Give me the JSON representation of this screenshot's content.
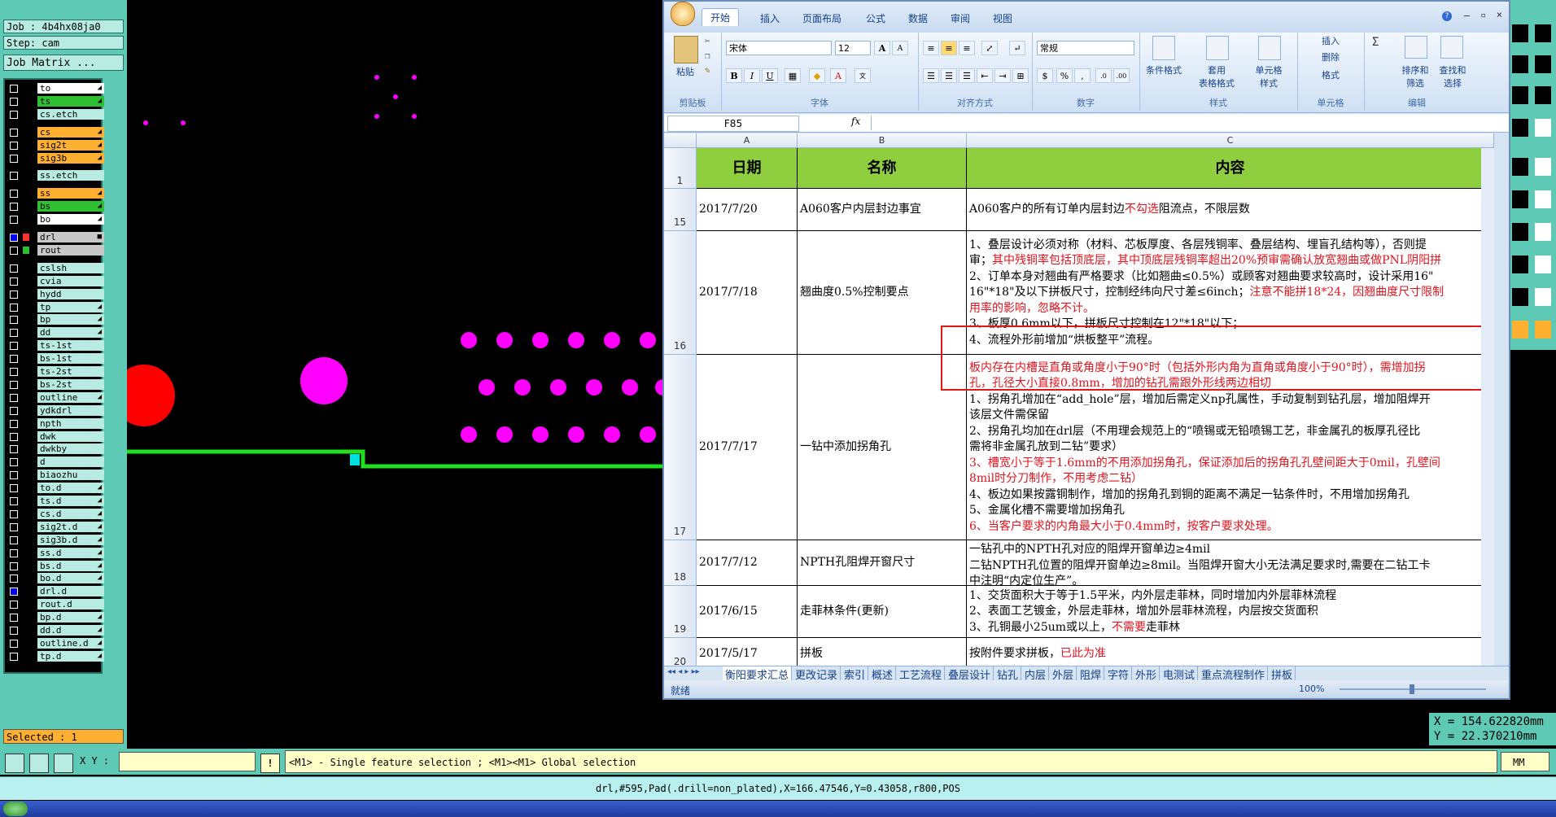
{
  "cam": {
    "job": "Job : 4b4hx08ja0",
    "step": "Step: cam",
    "job_matrix": "Job Matrix ...",
    "selected": "Selected : 1",
    "layers": [
      {
        "name": "to",
        "style": "white",
        "flag": "◢"
      },
      {
        "name": "ts",
        "style": "green",
        "flag": "◢"
      },
      {
        "name": "cs.etch",
        "style": "",
        "flag": ""
      },
      {
        "name": "cs",
        "style": "orange",
        "flag": "◢"
      },
      {
        "name": "sig2t",
        "style": "orange",
        "flag": "◢"
      },
      {
        "name": "sig3b",
        "style": "orange",
        "flag": "◢"
      },
      {
        "name": "ss.etch",
        "style": "",
        "flag": ""
      },
      {
        "name": "ss",
        "style": "orange",
        "flag": "◢"
      },
      {
        "name": "bs",
        "style": "green",
        "flag": "◢"
      },
      {
        "name": "bo",
        "style": "white",
        "flag": "◢"
      },
      {
        "name": "drl",
        "style": "grey",
        "flag": "■"
      },
      {
        "name": "rout",
        "style": "grey",
        "flag": ""
      },
      {
        "name": "cslsh",
        "style": "",
        "flag": ""
      },
      {
        "name": "cvia",
        "style": "",
        "flag": ""
      },
      {
        "name": "hydd",
        "style": "",
        "flag": ""
      },
      {
        "name": "tp",
        "style": "",
        "flag": "◢"
      },
      {
        "name": "bp",
        "style": "",
        "flag": "◢"
      },
      {
        "name": "dd",
        "style": "",
        "flag": "◢"
      },
      {
        "name": "ts-1st",
        "style": "",
        "flag": ""
      },
      {
        "name": "bs-1st",
        "style": "",
        "flag": ""
      },
      {
        "name": "ts-2st",
        "style": "",
        "flag": ""
      },
      {
        "name": "bs-2st",
        "style": "",
        "flag": ""
      },
      {
        "name": "outline",
        "style": "",
        "flag": "◢"
      },
      {
        "name": "ydkdrl",
        "style": "",
        "flag": ""
      },
      {
        "name": "npth",
        "style": "",
        "flag": ""
      },
      {
        "name": "dwk",
        "style": "",
        "flag": ""
      },
      {
        "name": "dwkby",
        "style": "",
        "flag": ""
      },
      {
        "name": "d",
        "style": "",
        "flag": ""
      },
      {
        "name": "biaozhu",
        "style": "",
        "flag": ""
      },
      {
        "name": "to.d",
        "style": "",
        "flag": "◢"
      },
      {
        "name": "ts.d",
        "style": "",
        "flag": "◢"
      },
      {
        "name": "cs.d",
        "style": "",
        "flag": "◢"
      },
      {
        "name": "sig2t.d",
        "style": "",
        "flag": "◢"
      },
      {
        "name": "sig3b.d",
        "style": "",
        "flag": "◢"
      },
      {
        "name": "ss.d",
        "style": "",
        "flag": "◢"
      },
      {
        "name": "bs.d",
        "style": "",
        "flag": "◢"
      },
      {
        "name": "bo.d",
        "style": "",
        "flag": "◢"
      },
      {
        "name": "drl.d",
        "style": "",
        "flag": ""
      },
      {
        "name": "rout.d",
        "style": "",
        "flag": ""
      },
      {
        "name": "bp.d",
        "style": "",
        "flag": "◢"
      },
      {
        "name": "dd.d",
        "style": "",
        "flag": "◢"
      },
      {
        "name": "outline.d",
        "style": "",
        "flag": "◢"
      },
      {
        "name": "tp.d",
        "style": "",
        "flag": "◢"
      }
    ],
    "xy_label": "X Y :",
    "prompt": "<M1> - Single feature selection ; <M1><M1> Global selection",
    "units": "MM",
    "info": "drl,#595,Pad(.drill=non_plated),X=166.47546,Y=0.43058,r800,POS",
    "coord_x": "X = 154.622820mm",
    "coord_y": "Y = 22.370210mm"
  },
  "excel": {
    "tabs": [
      "开始",
      "插入",
      "页面布局",
      "公式",
      "数据",
      "审阅",
      "视图"
    ],
    "font_name": "宋体",
    "font_size": "12",
    "number_format": "常规",
    "groups": {
      "clipboard": "剪贴板",
      "font": "字体",
      "align": "对齐方式",
      "number": "数字",
      "styles": "样式",
      "cells": "单元格",
      "edit": "编辑"
    },
    "paste": "粘贴",
    "cond_format": "条件格式",
    "table_format_1": "套用",
    "table_format_2": "表格格式",
    "cell_style_1": "单元格",
    "cell_style_2": "样式",
    "insert": "插入",
    "delete": "删除",
    "format": "格式",
    "sort_1": "排序和",
    "sort_2": "筛选",
    "find_1": "查找和",
    "find_2": "选择",
    "name_box": "F85",
    "fx": "fx",
    "cols": [
      "A",
      "B",
      "C"
    ],
    "headers": [
      "日期",
      "名称",
      "内容"
    ],
    "rows": [
      {
        "num": "15",
        "date": "2017/7/20",
        "name": "A060客户内层封边事宜",
        "lines": [
          [
            [
              "A060客户的所有订单内层封边",
              ""
            ],
            [
              "不勾选",
              "r"
            ],
            [
              "阻流点，不限层数",
              ""
            ]
          ]
        ]
      },
      {
        "num": "16",
        "date": "2017/7/18",
        "name": "翘曲度0.5%控制要点",
        "lines": [
          [
            [
              "1、叠层设计必须对称（材料、芯板厚度、各层残铜率、叠层结构、埋盲孔结构等），否则提",
              ""
            ]
          ],
          [
            [
              "审；",
              ""
            ],
            [
              "其中残铜率包括顶底层，其中顶底层残铜率超出20%预审需确认放宽翘曲或做PNL阴阳拼",
              "r"
            ]
          ],
          [
            [
              "2、订单本身对翘曲有严格要求（比如翘曲≤0.5%）或顾客对翘曲要求较高时，设计采用16\"",
              ""
            ]
          ],
          [
            [
              "16\"*18\"及以下拼板尺寸，控制经纬向尺寸差≤6inch；",
              ""
            ],
            [
              "注意不能拼18*24，因翘曲度尺寸限制",
              "r"
            ]
          ],
          [
            [
              "用率的影响，忽略不计。",
              "r"
            ]
          ],
          [
            [
              "3、板厚0.6mm以下，拼板尺寸控制在12\"*18\"以下；",
              ""
            ]
          ],
          [
            [
              "4、流程外形前增加“烘板整平”流程。",
              ""
            ]
          ]
        ]
      },
      {
        "num": "17",
        "date": "2017/7/17",
        "name": "一钻中添加拐角孔",
        "lines": [
          [
            [
              "板内存在内槽是直角或角度小于90°时（包括外形内角为直角或角度小于90°时），需增加拐",
              "r"
            ]
          ],
          [
            [
              "孔，孔径大小直接0.8mm，增加的钻孔需跟外形线两边相切",
              "r"
            ]
          ],
          [
            [
              "1、拐角孔增加在“add_hole”层，增加后需定义np孔属性，手动复制到钻孔层，增加阻焊开",
              ""
            ]
          ],
          [
            [
              "该层文件需保留",
              ""
            ]
          ],
          [
            [
              "2、拐角孔均加在drl层（不用理会规范上的“喷锡或无铅喷锡工艺，非金属孔的板厚孔径比",
              ""
            ]
          ],
          [
            [
              "需将非金属孔放到二钻”要求）",
              ""
            ]
          ],
          [
            [
              "3、槽宽小于等于1.6mm的不用添加拐角孔，保证添加后的拐角孔孔壁间距大于0mil，孔壁间",
              "r"
            ]
          ],
          [
            [
              "8mil时分刀制作，不用考虑二钻）",
              "r"
            ]
          ],
          [
            [
              "4、板边如果按露铜制作，增加的拐角孔到铜的距离不满足一钻条件时，不用增加拐角孔",
              ""
            ]
          ],
          [
            [
              "5、金属化槽不需要增加拐角孔",
              ""
            ]
          ],
          [
            [
              "6、当客户要求的内角最大小于0.4mm时，按客户要求处理。",
              "r"
            ]
          ]
        ]
      },
      {
        "num": "18",
        "date": "2017/7/12",
        "name": "NPTH孔阻焊开窗尺寸",
        "lines": [
          [
            [
              "一钻孔中的NPTH孔对应的阻焊开窗单边≥4mil",
              ""
            ]
          ],
          [
            [
              "二钻NPTH孔位置的阻焊开窗单边≥8mil。当阻焊开窗大小无法满足要求时,需要在二钻工卡",
              ""
            ]
          ],
          [
            [
              "中注明“内定位生产”。",
              ""
            ]
          ]
        ]
      },
      {
        "num": "19",
        "date": "2017/6/15",
        "name": "走菲林条件(更新)",
        "lines": [
          [
            [
              "1、交货面积大于等于1.5平米，内外层走菲林，同时增加内外层菲林流程",
              ""
            ]
          ],
          [
            [
              "2、表面工艺镀金，外层走菲林，增加外层菲林流程，内层按交货面积",
              ""
            ]
          ],
          [
            [
              "3、孔铜最小25um或以上，",
              ""
            ],
            [
              "不需要",
              "r"
            ],
            [
              "走菲林",
              ""
            ]
          ]
        ]
      },
      {
        "num": "20",
        "date": "2017/5/17",
        "name": "拼板",
        "lines": [
          [
            [
              "按附件要求拼板，",
              ""
            ],
            [
              "已此为准",
              "r"
            ]
          ]
        ]
      }
    ],
    "sheet_tabs": [
      "衡阳要求汇总",
      "更改记录",
      "索引",
      "概述",
      "工艺流程",
      "叠层设计",
      "钻孔",
      "内层",
      "外层",
      "阻焊",
      "字符",
      "外形",
      "电测试",
      "重点流程制作",
      "拼板"
    ],
    "status": "就绪",
    "zoom": "100%"
  }
}
